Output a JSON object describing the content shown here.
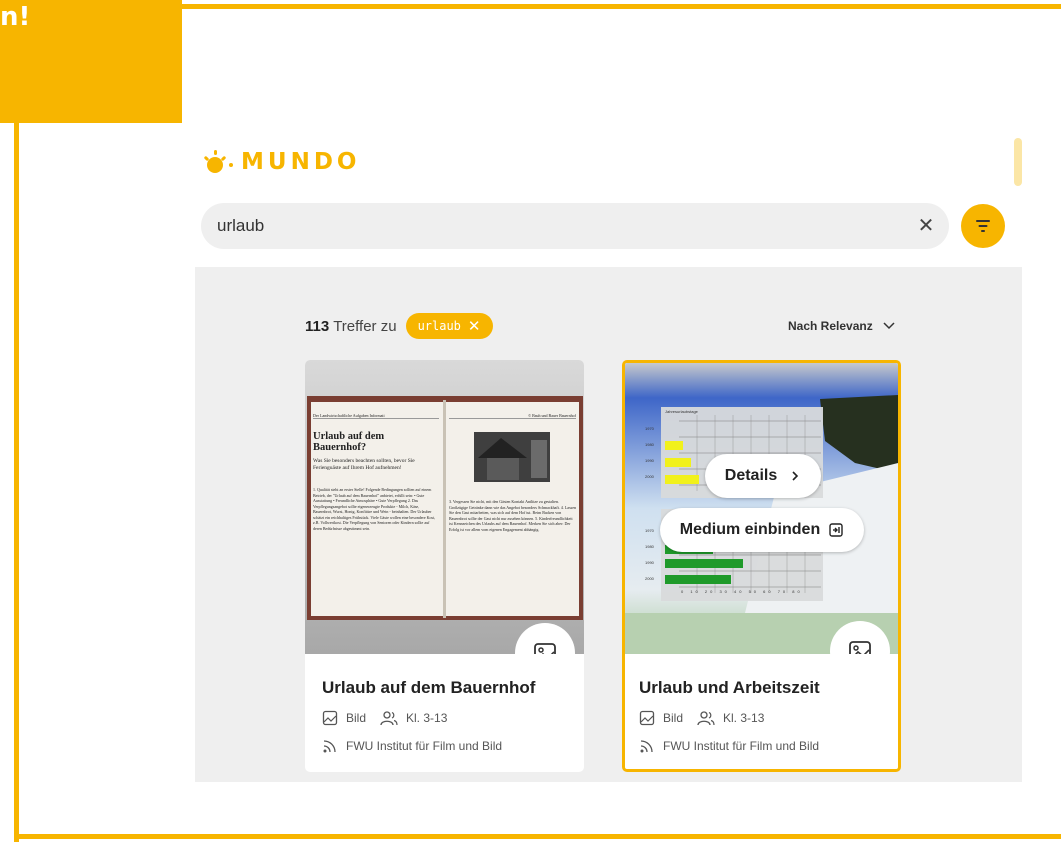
{
  "frame": {
    "corner_text": "n!",
    "accent": "#f7b500"
  },
  "logo": {
    "text": "MUNDO"
  },
  "search": {
    "value": "urlaub",
    "clear_icon": "close-icon",
    "filter_icon": "filter-icon"
  },
  "results": {
    "count": "113",
    "count_label": "Treffer zu",
    "chip_label": "urlaub",
    "sort_label": "Nach Relevanz"
  },
  "cards": [
    {
      "title": "Urlaub auf dem Bauernhof",
      "type": "Bild",
      "grade": "Kl. 3-13",
      "source": "FWU Institut für Film und Bild",
      "book": {
        "left_header": "Der Landwirtschaftliche Aufgaben Informati",
        "right_header": "© Bauh und Bauer Bauernhof",
        "heading": "Urlaub auf dem Bauernhof?",
        "intro": "Was Sie besonders beachten sollten, bevor Sie Ferienguäste auf Ihrem Hof aufnehmen!",
        "left_body": "1. Qualität steht an erster Stelle! Folgende Bedingungen sollten auf einem Betrieb, der \"Urlaub auf dem Bauernhof\" anbietet, erfüllt sein: • Gute Ausstattung • Freundliche Atmosphäre • Gute Verpflegung 2. Das Verpflegungsangebot sollte eigenerzeugte Produkte - Milch, Käse, Bauernbrot, Wurst, Honig, Konfitüre und Wein - beinhalten. Der Urlauber schätzt ein reichhaltiges Frühstück. Viele Gäste wollen eine besondere Kost, z.B. Vollwertkost. Die Verpflegung von Senioren oder Kindern sollte auf deren Bedürfnisse abgestimmt sein.",
        "right_body": "3. Vergessen Sie nicht, mit den Gästen Kontakt Antlitze zu gestalten. Großzügige Getränke dann wie das Angebot besonders Schmackhaft. 4. Lassen Sie den Gast mitarbeiten, was sich auf dem Hof tut. Beim Backen von Bauernbrot sollte der Gast nicht nur zusehen können. 5. Kinderfreundlichkeit ist Kennzeichen des Urlaubs auf dem Bauernhof. Merken Sie sich aber: Der Erfolg ist vor allem vom eigenen Engagement abhängig."
      }
    },
    {
      "title": "Urlaub und Arbeitszeit",
      "type": "Bild",
      "grade": "Kl. 3-13",
      "source": "FWU Institut für Film und Bild",
      "details_label": "Details",
      "embed_label": "Medium einbinden",
      "chart_title": "Jahresurlaubstage",
      "chart_rows_top": [
        "1970",
        "1980",
        "1990",
        "2000"
      ],
      "chart_rows_bottom": [
        "1970",
        "1980",
        "1990",
        "2000"
      ],
      "chart_axis": "0 10 20 30 40 50 60 70 80"
    }
  ]
}
